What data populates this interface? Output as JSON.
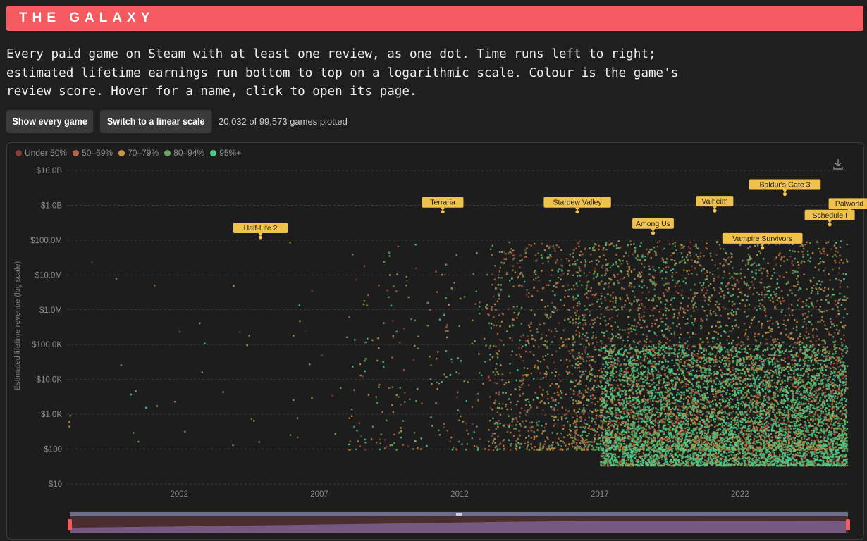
{
  "header": {
    "title": "THE GALAXY"
  },
  "intro": {
    "lines": [
      "Every paid game on Steam with at least one review, as one dot. Time runs left to right;",
      "estimated lifetime earnings run bottom to top on a logarithmic scale. Colour is the game's",
      "review score. Hover for a name, click to open its page."
    ]
  },
  "controls": {
    "show_all_label": "Show every game",
    "scale_toggle_label": "Switch to a linear scale",
    "count_text": "20,032 of 99,573 games plotted"
  },
  "icons": {
    "download": "download-icon",
    "handle": "drag-handle-icon"
  },
  "colors": {
    "accent": "#f45a5f",
    "background": "#1f1f1f",
    "annotation": "#f0c14b",
    "brush": "#9b7dc7"
  },
  "chart_data": {
    "type": "scatter",
    "title": "",
    "xlabel": "",
    "ylabel": "Estimated lifetime revenue (log scale)",
    "y_scale": "log",
    "xlim": [
      1998.0,
      2025.8
    ],
    "ylim": [
      10,
      10000000000
    ],
    "x_ticks": [
      2002,
      2007,
      2012,
      2017,
      2022
    ],
    "x_tick_labels": [
      "2002",
      "2007",
      "2012",
      "2017",
      "2022"
    ],
    "y_ticks": [
      10,
      100,
      1000,
      10000,
      100000,
      1000000,
      10000000,
      100000000,
      1000000000,
      10000000000
    ],
    "y_tick_labels": [
      "$10",
      "$100",
      "$1.0K",
      "$10.0K",
      "$100.0K",
      "$1.0M",
      "$10.0M",
      "$100.0M",
      "$1.0B",
      "$10.0B"
    ],
    "grid": true,
    "legend_position": "top-left",
    "legend": [
      {
        "label": "Under 50%",
        "color": "#8e3b37"
      },
      {
        "label": "50–69%",
        "color": "#b8613e"
      },
      {
        "label": "70–79%",
        "color": "#c9973f"
      },
      {
        "label": "80–94%",
        "color": "#6ca35c"
      },
      {
        "label": "95%+",
        "color": "#47d08c"
      }
    ],
    "annotations": [
      {
        "label": "Half-Life 2",
        "x": 2004.9,
        "y": 120000000
      },
      {
        "label": "Terraria",
        "x": 2011.4,
        "y": 650000000
      },
      {
        "label": "Stardew Valley",
        "x": 2016.2,
        "y": 650000000
      },
      {
        "label": "Among Us",
        "x": 2018.9,
        "y": 160000000
      },
      {
        "label": "Valheim",
        "x": 2021.1,
        "y": 700000000
      },
      {
        "label": "Baldur's Gate 3",
        "x": 2023.6,
        "y": 2100000000
      },
      {
        "label": "Vampire Survivors",
        "x": 2022.8,
        "y": 60000000
      },
      {
        "label": "Schedule I",
        "x": 2025.2,
        "y": 280000000
      },
      {
        "label": "Palworld",
        "x": 2025.9,
        "y": 600000000
      }
    ],
    "density": [
      {
        "x_range": [
          1998.0,
          2008.0
        ],
        "y_range": [
          100,
          100000000
        ],
        "count": 45,
        "mix": [
          0.12,
          0.15,
          0.28,
          0.3,
          0.15
        ]
      },
      {
        "x_range": [
          2008.0,
          2013.0
        ],
        "y_range": [
          100,
          100000000
        ],
        "count": 240,
        "mix": [
          0.12,
          0.18,
          0.25,
          0.3,
          0.15
        ]
      },
      {
        "x_range": [
          2013.0,
          2016.0
        ],
        "y_range": [
          100,
          100000000
        ],
        "count": 700,
        "mix": [
          0.12,
          0.25,
          0.3,
          0.23,
          0.1
        ]
      },
      {
        "x_range": [
          2016.0,
          2025.8
        ],
        "y_range": [
          100,
          100000000
        ],
        "count": 4200,
        "mix": [
          0.1,
          0.2,
          0.28,
          0.27,
          0.15
        ]
      },
      {
        "x_range": [
          2017.0,
          2025.8
        ],
        "y_range": [
          35,
          100000
        ],
        "count": 5200,
        "mix": [
          0.05,
          0.06,
          0.12,
          0.22,
          0.55
        ]
      }
    ]
  }
}
